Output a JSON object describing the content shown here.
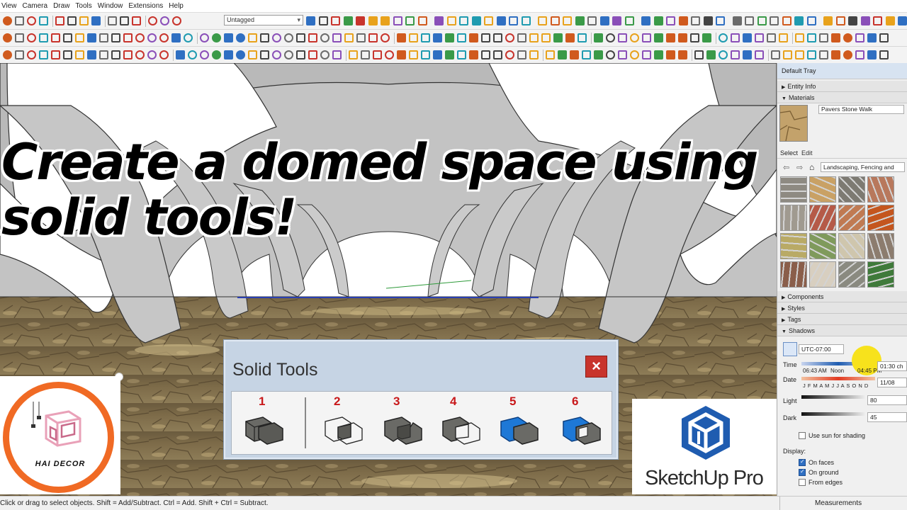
{
  "menubar": {
    "items": [
      "View",
      "Camera",
      "Draw",
      "Tools",
      "Window",
      "Extensions",
      "Help"
    ]
  },
  "toolbar": {
    "tag_select": "Untagged"
  },
  "viewport": {
    "headline_line1": "Create a domed space using",
    "headline_line2": "solid tools!"
  },
  "solid_tools": {
    "title": "Solid Tools",
    "close_icon": "close-icon",
    "tools": [
      {
        "number": "1",
        "icon": "outer-shell-icon"
      },
      {
        "number": "2",
        "icon": "intersect-icon"
      },
      {
        "number": "3",
        "icon": "union-icon"
      },
      {
        "number": "4",
        "icon": "subtract-icon"
      },
      {
        "number": "5",
        "icon": "trim-icon"
      },
      {
        "number": "6",
        "icon": "split-icon"
      }
    ]
  },
  "logos": {
    "hai_decor": "HAI DECOR",
    "sketchup": "SketchUp Pro"
  },
  "tray": {
    "title": "Default Tray",
    "entity_info": "Entity Info",
    "materials": "Materials",
    "material_name": "Pavers Stone Walk",
    "tab_select": "Select",
    "tab_edit": "Edit",
    "library": "Landscaping, Fencing and",
    "components": "Components",
    "styles": "Styles",
    "tags": "Tags",
    "shadows": "Shadows",
    "timezone": "UTC-07:00",
    "time_label": "Time",
    "time_start": "06:43 AM",
    "time_noon": "Noon",
    "time_end": "04:45 PM",
    "time_value": "01:30 ch",
    "date_label": "Date",
    "months": "J F M A M J J A S O N D",
    "date_value": "11/08",
    "light_label": "Light",
    "light_value": "80",
    "dark_label": "Dark",
    "dark_value": "45",
    "use_sun": "Use sun for shading",
    "display_label": "Display:",
    "on_faces": "On faces",
    "on_ground": "On ground",
    "from_edges": "From edges"
  },
  "status": {
    "hint": "Click or drag to select objects. Shift = Add/Subtract. Ctrl = Add. Shift + Ctrl = Subtract.",
    "measurements_label": "Measurements"
  }
}
